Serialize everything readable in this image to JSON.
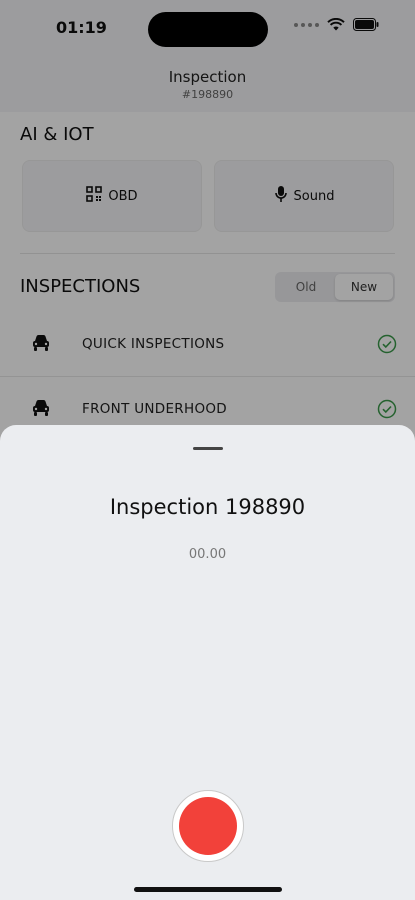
{
  "status_bar": {
    "time": "01:19"
  },
  "header": {
    "title": "Inspection",
    "subtitle": "#198890"
  },
  "ai_iot": {
    "title": "AI & IOT",
    "tiles": [
      {
        "label": "OBD",
        "icon": "qr-code-icon"
      },
      {
        "label": "Sound",
        "icon": "microphone-icon"
      }
    ]
  },
  "inspections": {
    "title": "INSPECTIONS",
    "toggle": {
      "options": [
        "Old",
        "New"
      ],
      "selected": "New"
    },
    "items": [
      {
        "label": "QUICK INSPECTIONS",
        "icon": "car-icon",
        "status": "check-circle-icon"
      },
      {
        "label": "FRONT UNDERHOOD",
        "icon": "car-icon",
        "status": "check-circle-icon"
      }
    ]
  },
  "sheet": {
    "title": "Inspection 198890",
    "timer": "00.00"
  },
  "colors": {
    "record": "#f2413a",
    "check": "#3a9a4a",
    "sheet_bg": "#ebedf0"
  }
}
